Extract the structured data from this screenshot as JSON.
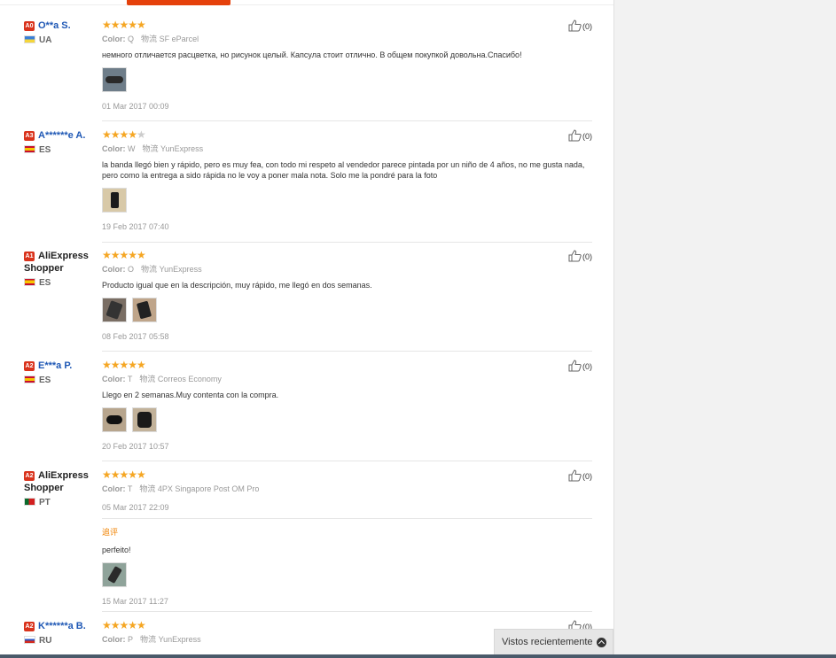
{
  "reviews": [
    {
      "level": "A0",
      "name": "O**a S.",
      "country": "UA",
      "flag": "ua",
      "stars": 5,
      "color_label": "Color:",
      "color_value": "Q",
      "ship_label": "物流",
      "ship_value": "SF eParcel",
      "text": "немного отличается расцветка, но рисунок целый. Капсула стоит отлично. В общем покупкой довольна.Спасибо!",
      "date": "01 Mar 2017 00:09",
      "likes": "(0)"
    },
    {
      "level": "A3",
      "name": "A******e A.",
      "country": "ES",
      "flag": "es",
      "stars": 4,
      "color_label": "Color:",
      "color_value": "W",
      "ship_label": "物流",
      "ship_value": "YunExpress",
      "text": "la banda llegó bien y rápido, pero es muy fea, con todo mi respeto al vendedor parece pintada por un niño de 4 años, no me gusta nada, pero como la entrega a sido rápida no le voy a poner mala nota. Solo me la pondré para la foto",
      "date": "19 Feb 2017 07:40",
      "likes": "(0)"
    },
    {
      "level": "A1",
      "name": "AliExpress Shopper",
      "country": "ES",
      "flag": "es",
      "stars": 5,
      "color_label": "Color:",
      "color_value": "O",
      "ship_label": "物流",
      "ship_value": "YunExpress",
      "text": "Producto igual que en la descripción, muy rápido, me llegó en dos semanas.",
      "date": "08 Feb 2017 05:58",
      "likes": "(0)"
    },
    {
      "level": "A2",
      "name": "E***a P.",
      "country": "ES",
      "flag": "es",
      "stars": 5,
      "color_label": "Color:",
      "color_value": "T",
      "ship_label": "物流",
      "ship_value": "Correos Economy",
      "text": "Llego en 2 semanas.Muy contenta con la compra.",
      "date": "20 Feb 2017 10:57",
      "likes": "(0)"
    },
    {
      "level": "A2",
      "name": "AliExpress Shopper",
      "country": "PT",
      "flag": "pt",
      "stars": 5,
      "color_label": "Color:",
      "color_value": "T",
      "ship_label": "物流",
      "ship_value": "4PX Singapore Post OM Pro",
      "date": "05 Mar 2017 22:09",
      "likes": "(0)",
      "additional_title": "追评",
      "additional_text": "perfeito!",
      "additional_date": "15 Mar 2017 11:27"
    },
    {
      "level": "A2",
      "name": "K******a B.",
      "country": "RU",
      "flag": "ru",
      "stars": 5,
      "color_label": "Color:",
      "color_value": "P",
      "ship_label": "物流",
      "ship_value": "YunExpress",
      "likes": "(0)"
    }
  ],
  "recently_viewed": "Vistos recientemente"
}
